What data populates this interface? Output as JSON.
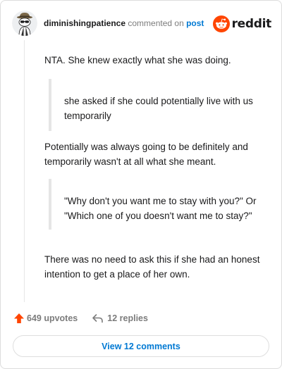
{
  "header": {
    "username": "diminishingpatience",
    "commented_text": "commented on",
    "post_link": "post",
    "logo_text": "reddit",
    "avatar_icon": "snoo-avatar-icon",
    "logo_icon": "reddit-alien-icon",
    "brand_color": "#ff4500"
  },
  "comment": {
    "paragraph_1": "NTA. She knew exactly what she was doing.",
    "quote_1": "she asked if she could potentially live with us temporarily",
    "paragraph_2": "Potentially was always going to be definitely and temporarily wasn't at all what she meant.",
    "quote_2": "\"Why don't you want me to stay with you?\" Or \"Which one of you doesn't want me to stay?\"",
    "paragraph_3": "There was no need to ask this if she had an honest intention to get a place of her own."
  },
  "actions": {
    "upvotes": "649 upvotes",
    "replies": "12 replies",
    "upvote_icon": "upvote-arrow-icon",
    "reply_icon": "reply-arrow-icon",
    "upvote_color": "#ff4500"
  },
  "footer": {
    "view_comments": "View 12 comments",
    "link_color": "#0079d3"
  }
}
